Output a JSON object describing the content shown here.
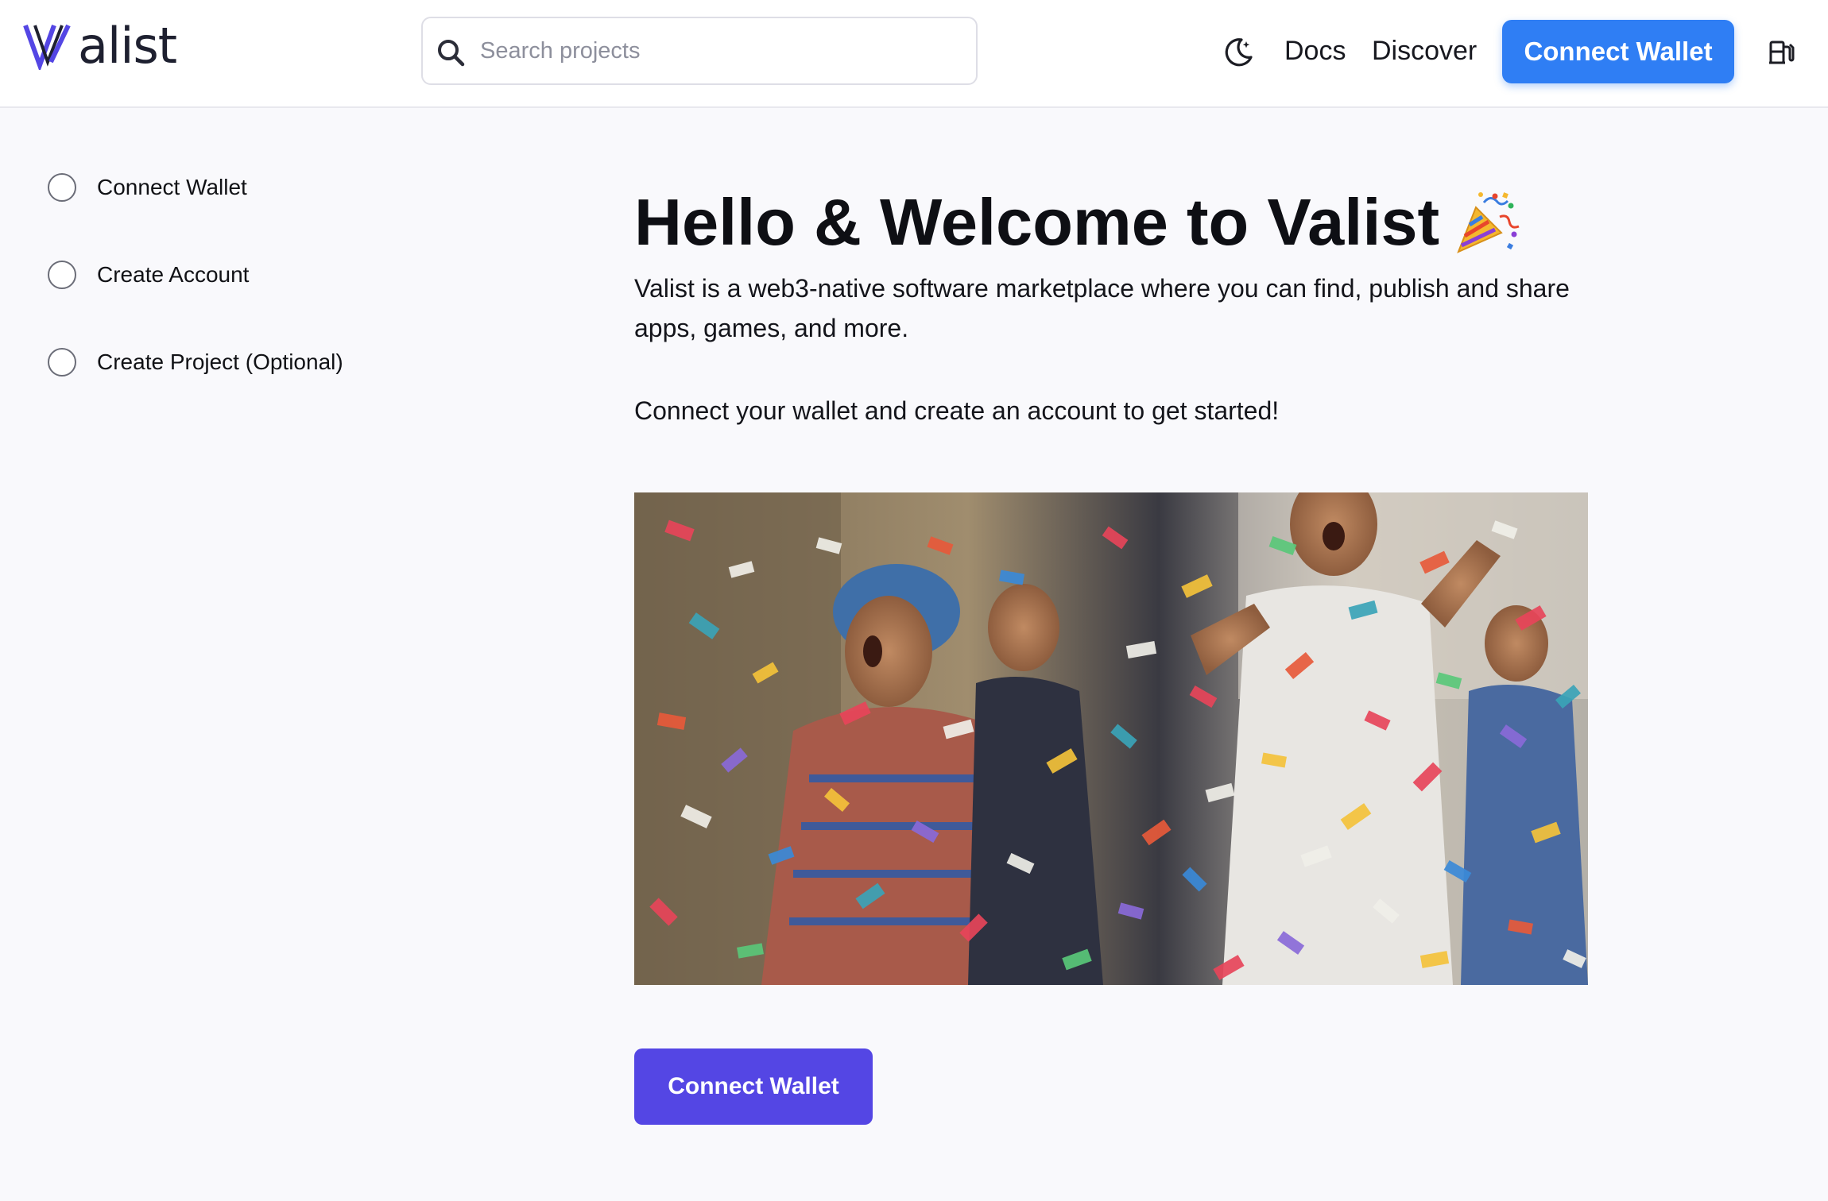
{
  "header": {
    "logo_text": "alist",
    "logo_icon": "valist-v-logo-icon",
    "search": {
      "placeholder": "Search projects",
      "value": ""
    },
    "theme_toggle_icon": "moon-icon",
    "nav": {
      "docs": "Docs",
      "discover": "Discover"
    },
    "connect_label": "Connect Wallet",
    "gas_icon": "gas-pump-icon"
  },
  "steps": [
    {
      "label": "Connect Wallet",
      "completed": false
    },
    {
      "label": "Create Account",
      "completed": false
    },
    {
      "label": "Create Project (Optional)",
      "completed": false
    }
  ],
  "main": {
    "title": "Hello & Welcome to Valist",
    "title_icon": "party-popper-icon",
    "intro": "Valist is a web3-native software marketplace where you can find, publish and share apps, games, and more.",
    "cta_text": "Connect your wallet and create an account to get started!",
    "image": "confetti-celebration-image",
    "connect_label": "Connect Wallet"
  },
  "colors": {
    "header_button": "#2f7ef4",
    "primary_button": "#5446e4",
    "logo_accent": "#5446e4",
    "background": "#f9f9fc"
  }
}
